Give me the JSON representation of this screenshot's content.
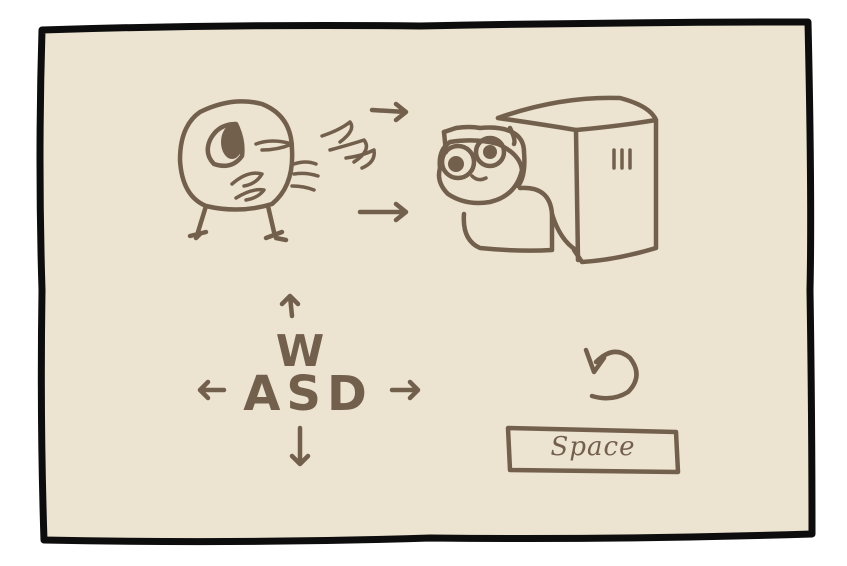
{
  "controls": {
    "up_key": "W",
    "horizontal_keys": "ASD",
    "action_key": "Space"
  },
  "icons": {
    "player": "bird-icon",
    "enemy": "cat-in-box-icon",
    "movement": "arrow-icons",
    "reset": "undo-circular-arrow-icon"
  },
  "colors": {
    "background": "#ece3d1",
    "ink": "#73604c",
    "frame": "#0d0d0d"
  }
}
